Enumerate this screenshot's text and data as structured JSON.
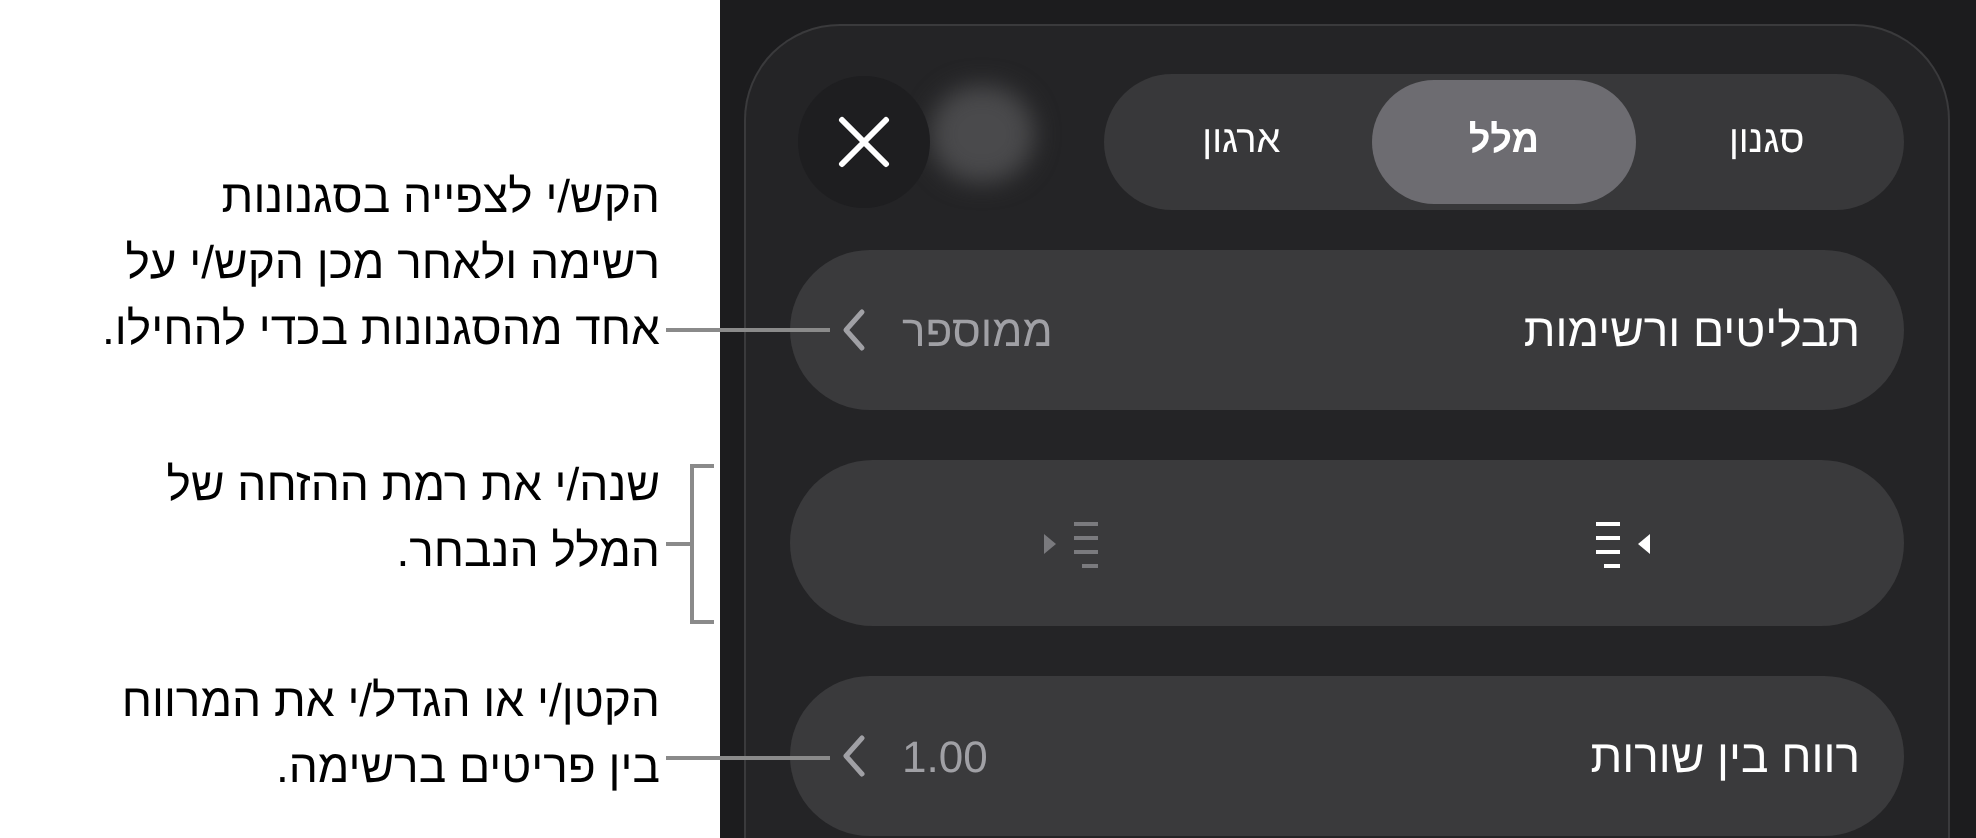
{
  "callouts": [
    {
      "text": "הקש/י לצפייה בסגנונות\nרשימה ולאחר מכן הקש/י על\nאחד מהסגנונות בכדי להחילו."
    },
    {
      "text": "שנה/י את רמת ההזחה של\nהמלל הנבחר."
    },
    {
      "text": "הקטן/י או הגדל/י את המרווח\nבין פריטים ברשימה."
    }
  ],
  "tabs": [
    {
      "label": "סגנון",
      "selected": false
    },
    {
      "label": "מלל",
      "selected": true
    },
    {
      "label": "ארגון",
      "selected": false
    }
  ],
  "rows": [
    {
      "kind": "disclosure",
      "label": "תבליטים ורשימות",
      "value": "ממוספר"
    },
    {
      "kind": "indent",
      "buttons": [
        {
          "disabled": false
        },
        {
          "disabled": true
        }
      ]
    },
    {
      "kind": "disclosure",
      "label": "רווח בין שורות",
      "value": "1.00"
    }
  ]
}
